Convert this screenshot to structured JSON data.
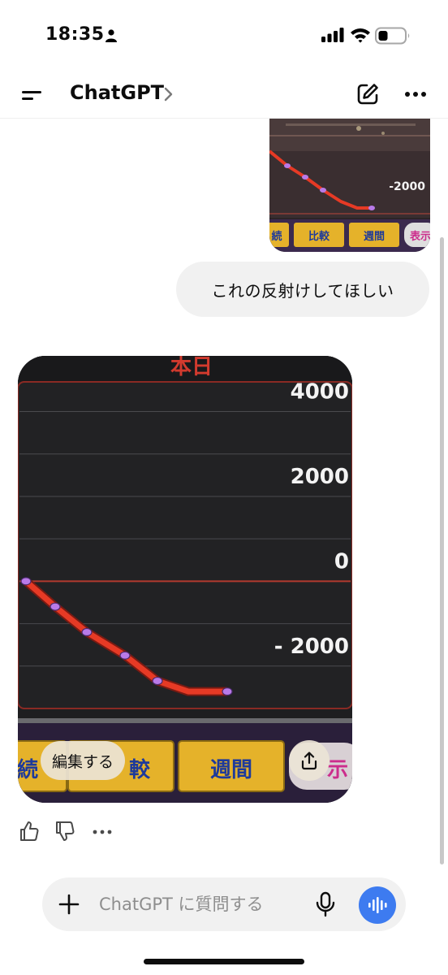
{
  "status_bar": {
    "time": "18:35"
  },
  "header": {
    "title": "ChatGPT"
  },
  "messages": {
    "user_image": {
      "tick_label": "-2000",
      "buttons": [
        "続",
        "比較",
        "週間",
        "表示"
      ]
    },
    "user_text": "これの反射けしてほしい",
    "ai_image": {
      "title": "本日",
      "y_ticks": [
        "4000",
        "2000",
        "0",
        "- 2000"
      ],
      "buttons": [
        "続",
        "較",
        "週間",
        "示"
      ],
      "edit_label": "編集する"
    }
  },
  "chart_data": {
    "type": "line",
    "title": "本日",
    "y_ticks": [
      4000,
      2000,
      0,
      -2000
    ],
    "ylim": [
      -3000,
      4700
    ],
    "series": [
      {
        "values": [
          0,
          -600,
          -1200,
          -1750,
          -2350,
          -2600,
          -2600
        ]
      }
    ]
  },
  "composer": {
    "placeholder": "ChatGPT に質問する"
  },
  "colors": {
    "accent": "#3d7bf0",
    "chart_line": "#e63a25",
    "chart_point": "#b97ae8",
    "button_gold": "#e5b22a"
  }
}
